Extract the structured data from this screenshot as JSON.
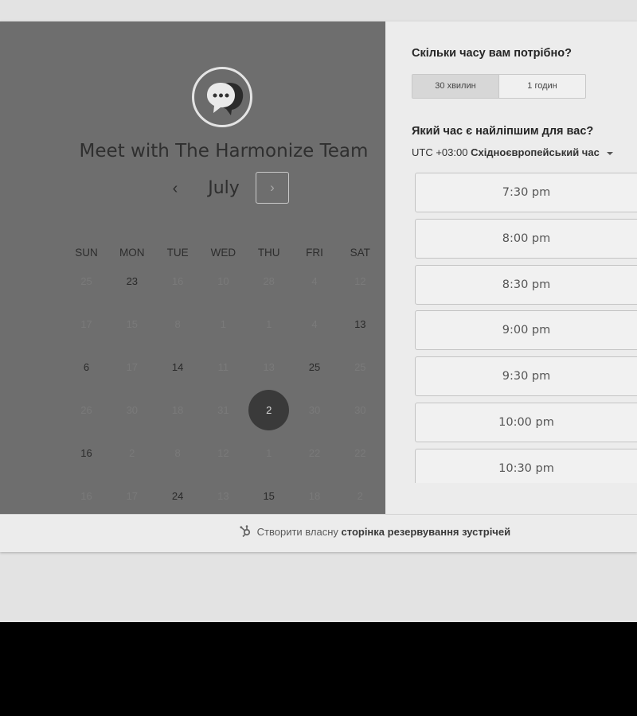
{
  "calendar": {
    "title": "Meet with The Harmonize Team",
    "month": "July",
    "prev_glyph": "‹",
    "next_glyph": "›",
    "weekdays": [
      "SUN",
      "MON",
      "TUE",
      "WED",
      "THU",
      "FRI",
      "SAT"
    ],
    "weeks": [
      [
        {
          "d": "25",
          "a": false
        },
        {
          "d": "23",
          "a": true
        },
        {
          "d": "16",
          "a": false
        },
        {
          "d": "10",
          "a": false
        },
        {
          "d": "28",
          "a": false
        },
        {
          "d": "4",
          "a": false
        },
        {
          "d": "12",
          "a": false
        }
      ],
      [
        {
          "d": "17",
          "a": false
        },
        {
          "d": "15",
          "a": false
        },
        {
          "d": "8",
          "a": false
        },
        {
          "d": "1",
          "a": false
        },
        {
          "d": "1",
          "a": false
        },
        {
          "d": "4",
          "a": false
        },
        {
          "d": "13",
          "a": true
        }
      ],
      [
        {
          "d": "6",
          "a": true
        },
        {
          "d": "17",
          "a": false
        },
        {
          "d": "14",
          "a": true
        },
        {
          "d": "11",
          "a": false
        },
        {
          "d": "13",
          "a": false
        },
        {
          "d": "25",
          "a": true
        },
        {
          "d": "25",
          "a": false
        }
      ],
      [
        {
          "d": "26",
          "a": false
        },
        {
          "d": "30",
          "a": false
        },
        {
          "d": "18",
          "a": false
        },
        {
          "d": "31",
          "a": false
        },
        {
          "d": "2",
          "a": true,
          "selected": true
        },
        {
          "d": "30",
          "a": false
        },
        {
          "d": "30",
          "a": false
        }
      ],
      [
        {
          "d": "16",
          "a": true
        },
        {
          "d": "2",
          "a": false
        },
        {
          "d": "8",
          "a": false
        },
        {
          "d": "12",
          "a": false
        },
        {
          "d": "1",
          "a": false
        },
        {
          "d": "22",
          "a": false
        },
        {
          "d": "22",
          "a": false
        }
      ],
      [
        {
          "d": "16",
          "a": false
        },
        {
          "d": "17",
          "a": false
        },
        {
          "d": "24",
          "a": true
        },
        {
          "d": "13",
          "a": false
        },
        {
          "d": "15",
          "a": true
        },
        {
          "d": "18",
          "a": false
        },
        {
          "d": "2",
          "a": false
        }
      ]
    ]
  },
  "booking": {
    "duration_title": "Скільки часу вам потрібно?",
    "duration_options": [
      {
        "label": "30 хвилин",
        "active": true
      },
      {
        "label": "1 годин",
        "active": false
      }
    ],
    "best_time_title": "Який час є найліпшим для вас?",
    "timezone_offset": "UTC +03:00",
    "timezone_name": "Східноєвропейський час",
    "time_slots": [
      "7:30 pm",
      "8:00 pm",
      "8:30 pm",
      "9:00 pm",
      "9:30 pm",
      "10:00 pm",
      "10:30 pm"
    ]
  },
  "footer": {
    "text_prefix": "Створити власну",
    "text_bold": "сторінка резервування зустрічей"
  },
  "colors": {
    "left_panel": "#6e6e6e",
    "selected_day": "#3a3a3a",
    "right_panel": "#ececec"
  }
}
